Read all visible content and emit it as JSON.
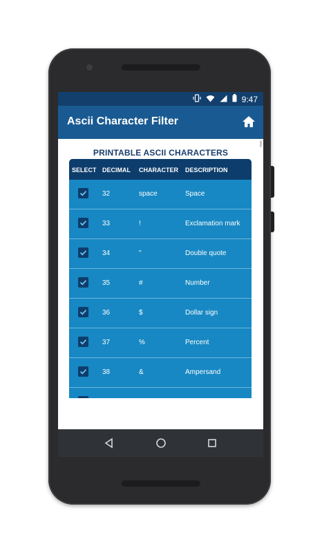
{
  "status_bar": {
    "time": "9:47",
    "icons": [
      "vibrate-icon",
      "wifi-icon",
      "signal-icon",
      "battery-icon"
    ]
  },
  "app_bar": {
    "title": "Ascii Character Filter",
    "home_icon": "home-icon"
  },
  "section_title": "PRINTABLE ASCII CHARACTERS",
  "table": {
    "columns": [
      "SELECT",
      "DECIMAL",
      "CHARACTER",
      "DESCRIPTION"
    ],
    "rows": [
      {
        "selected": true,
        "decimal": "32",
        "character": "space",
        "description": "Space"
      },
      {
        "selected": true,
        "decimal": "33",
        "character": "!",
        "description": "Exclamation mark"
      },
      {
        "selected": true,
        "decimal": "34",
        "character": "\"",
        "description": "Double quote"
      },
      {
        "selected": true,
        "decimal": "35",
        "character": "#",
        "description": "Number"
      },
      {
        "selected": true,
        "decimal": "36",
        "character": "$",
        "description": "Dollar sign"
      },
      {
        "selected": true,
        "decimal": "37",
        "character": "%",
        "description": "Percent"
      },
      {
        "selected": true,
        "decimal": "38",
        "character": "&",
        "description": "Ampersand"
      }
    ]
  },
  "nav_bar": [
    "back-icon",
    "home-circle-icon",
    "recents-icon"
  ],
  "colors": {
    "status_bar": "#123f6c",
    "app_bar": "#1a5a92",
    "table_header": "#0d3d6c",
    "table_row": "#1788c3",
    "section_title": "#1b3e6e"
  }
}
